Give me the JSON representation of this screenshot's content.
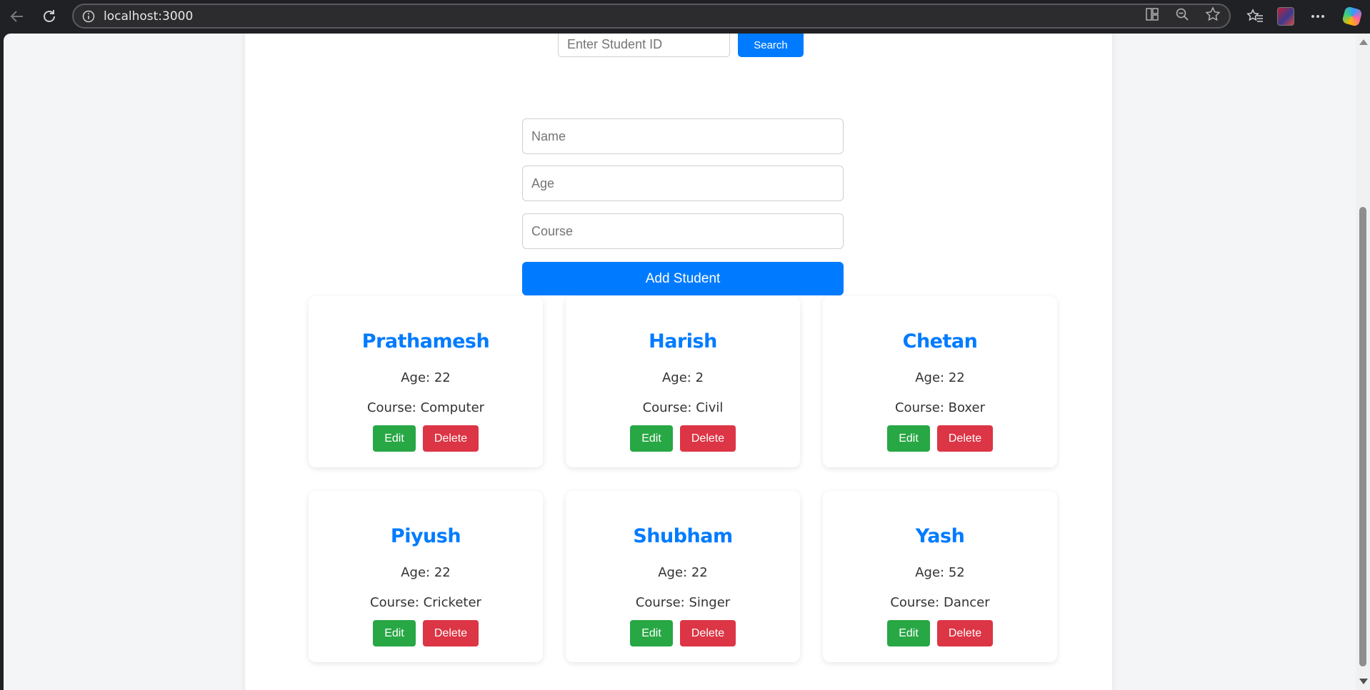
{
  "browser": {
    "url": "localhost:3000"
  },
  "search": {
    "placeholder": "Enter Student ID",
    "button_label": "Search"
  },
  "form": {
    "name_placeholder": "Name",
    "age_placeholder": "Age",
    "course_placeholder": "Course",
    "submit_label": "Add Student"
  },
  "cards": [
    {
      "name": "Prathamesh",
      "age": "Age: 22",
      "course": "Course: Computer",
      "edit": "Edit",
      "delete": "Delete"
    },
    {
      "name": "Harish",
      "age": "Age: 2",
      "course": "Course: Civil",
      "edit": "Edit",
      "delete": "Delete"
    },
    {
      "name": "Chetan",
      "age": "Age: 22",
      "course": "Course: Boxer",
      "edit": "Edit",
      "delete": "Delete"
    },
    {
      "name": "Piyush",
      "age": "Age: 22",
      "course": "Course: Cricketer",
      "edit": "Edit",
      "delete": "Delete"
    },
    {
      "name": "Shubham",
      "age": "Age: 22",
      "course": "Course: Singer",
      "edit": "Edit",
      "delete": "Delete"
    },
    {
      "name": "Yash",
      "age": "Age: 52",
      "course": "Course: Dancer",
      "edit": "Edit",
      "delete": "Delete"
    }
  ],
  "colors": {
    "primary": "#007bff",
    "edit": "#28a745",
    "delete": "#dc3545"
  },
  "icons": [
    "back-icon",
    "reload-icon",
    "info-icon",
    "split-screen-icon",
    "zoom-out-icon",
    "favorite-star-icon",
    "favorites-icon",
    "profile-icon",
    "more-icon",
    "copilot-icon"
  ]
}
